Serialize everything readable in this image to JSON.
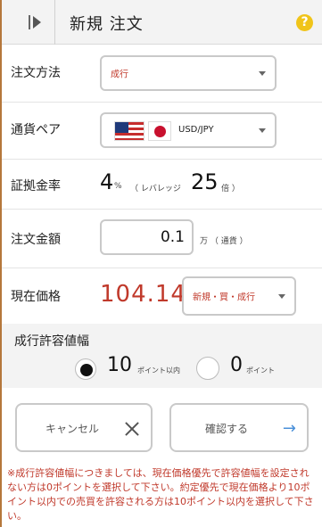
{
  "header": {
    "title": "新規 注文"
  },
  "order_method": {
    "label": "注文方法",
    "value": "成行"
  },
  "currency_pair": {
    "label": "通貨ペア",
    "value": "USD/JPY"
  },
  "margin_rate": {
    "label": "証拠金率",
    "percent": "4",
    "percent_unit": "%",
    "leverage_prefix": "（ レバレッジ",
    "leverage": "25",
    "leverage_unit": "倍 ）"
  },
  "order_amount": {
    "label": "注文金額",
    "value": "0.1",
    "unit": "万 （ 通貨 ）"
  },
  "current_price": {
    "label": "現在価格",
    "value": "104.14",
    "type_select": "新規・買・成行"
  },
  "slippage": {
    "label": "成行許容値幅",
    "option1_value": "10",
    "option1_unit": "ポイント以内",
    "option2_value": "0",
    "option2_unit": "ポイント",
    "selected": "option1"
  },
  "buttons": {
    "cancel": "キャンセル",
    "confirm": "確認する"
  },
  "footnote": "※成行許容値幅につきましては、現在価格優先で許容値幅を設定されない方は0ポイントを選択して下さい。約定優先で現在価格より10ポイント以内での売買を許容される方は10ポイント以内を選択して下さい。"
}
